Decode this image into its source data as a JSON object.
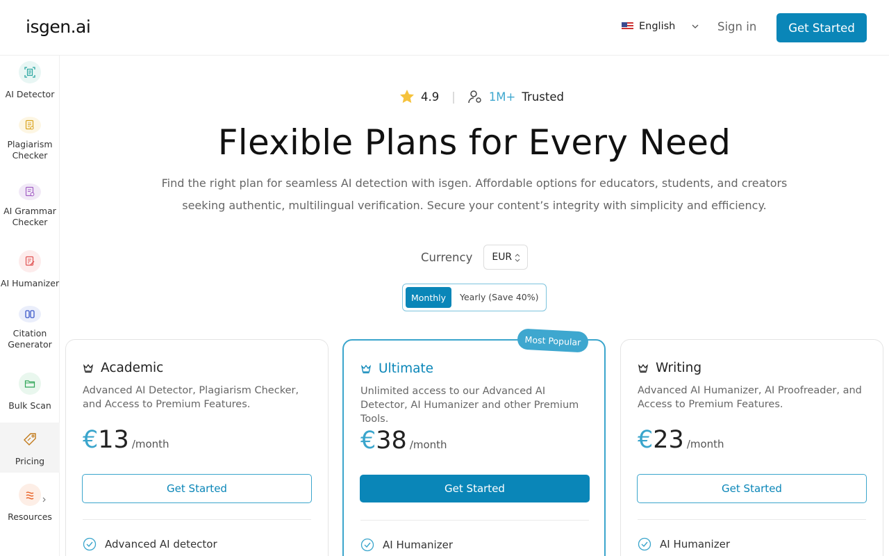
{
  "header": {
    "logo": "isgen.ai",
    "language": "English",
    "sign_in": "Sign in",
    "get_started": "Get Started"
  },
  "sidebar": {
    "items": [
      {
        "label": "AI Detector",
        "icon": "document-scan-icon"
      },
      {
        "label": "Plagiarism Checker",
        "icon": "document-search-icon"
      },
      {
        "label": "AI Grammar Checker",
        "icon": "document-edit-icon"
      },
      {
        "label": "AI Humanizer",
        "icon": "document-pen-icon"
      },
      {
        "label": "Citation Generator",
        "icon": "quote-icon"
      },
      {
        "label": "Bulk Scan",
        "icon": "folder-icon"
      },
      {
        "label": "Pricing",
        "icon": "tag-icon"
      },
      {
        "label": "Resources",
        "icon": "resources-icon"
      }
    ]
  },
  "hero": {
    "rating": "4.9",
    "users_count": "1M+",
    "trusted": "Trusted",
    "title": "Flexible Plans for Every Need",
    "subtitle": "Find the right plan for seamless AI detection with isgen. Affordable options for educators, students, and creators seeking authentic, multilingual verification. Secure your content’s integrity with simplicity and efficiency."
  },
  "currency": {
    "label": "Currency",
    "selected": "EUR"
  },
  "billing": {
    "monthly": "Monthly",
    "yearly": "Yearly (Save 40%)",
    "selected": "Monthly"
  },
  "plans": [
    {
      "name": "Academic",
      "description": "Advanced AI Detector, Plagiarism Checker, and Access to Premium Features.",
      "currency_symbol": "€",
      "price": "13",
      "period": "/month",
      "cta": "Get Started",
      "first_feature": "Advanced AI detector"
    },
    {
      "name": "Ultimate",
      "badge": "Most Popular",
      "description": "Unlimited access to our Advanced AI Detector, AI Humanizer and other Premium Tools.",
      "currency_symbol": "€",
      "price": "38",
      "period": "/month",
      "cta": "Get Started",
      "first_feature": "AI Humanizer"
    },
    {
      "name": "Writing",
      "description": "Advanced AI Humanizer, AI Proofreader, and Access to Premium Features.",
      "currency_symbol": "€",
      "price": "23",
      "period": "/month",
      "cta": "Get Started",
      "first_feature": "AI Humanizer"
    }
  ],
  "colors": {
    "brand": "#0a86b8",
    "accent_light": "#3ea7cf"
  }
}
